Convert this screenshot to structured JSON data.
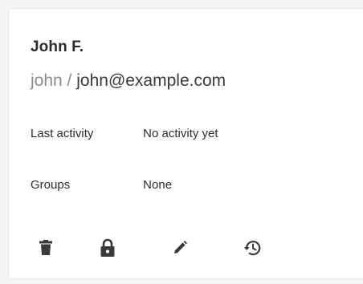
{
  "user_card": {
    "name": "John F.",
    "username": "john",
    "separator": "/",
    "email": "john@example.com",
    "last_activity_label": "Last activity",
    "last_activity_value": "No activity yet",
    "groups_label": "Groups",
    "groups_value": "None",
    "actions": [
      {
        "icon": "trash-icon"
      },
      {
        "icon": "lock-icon"
      },
      {
        "icon": "pencil-icon"
      },
      {
        "icon": "history-icon"
      }
    ]
  },
  "colors": {
    "text": "#2b2b2b",
    "muted": "#8a8a8a",
    "icon": "#3a3a3a",
    "card_border": "#e6e6e6"
  }
}
